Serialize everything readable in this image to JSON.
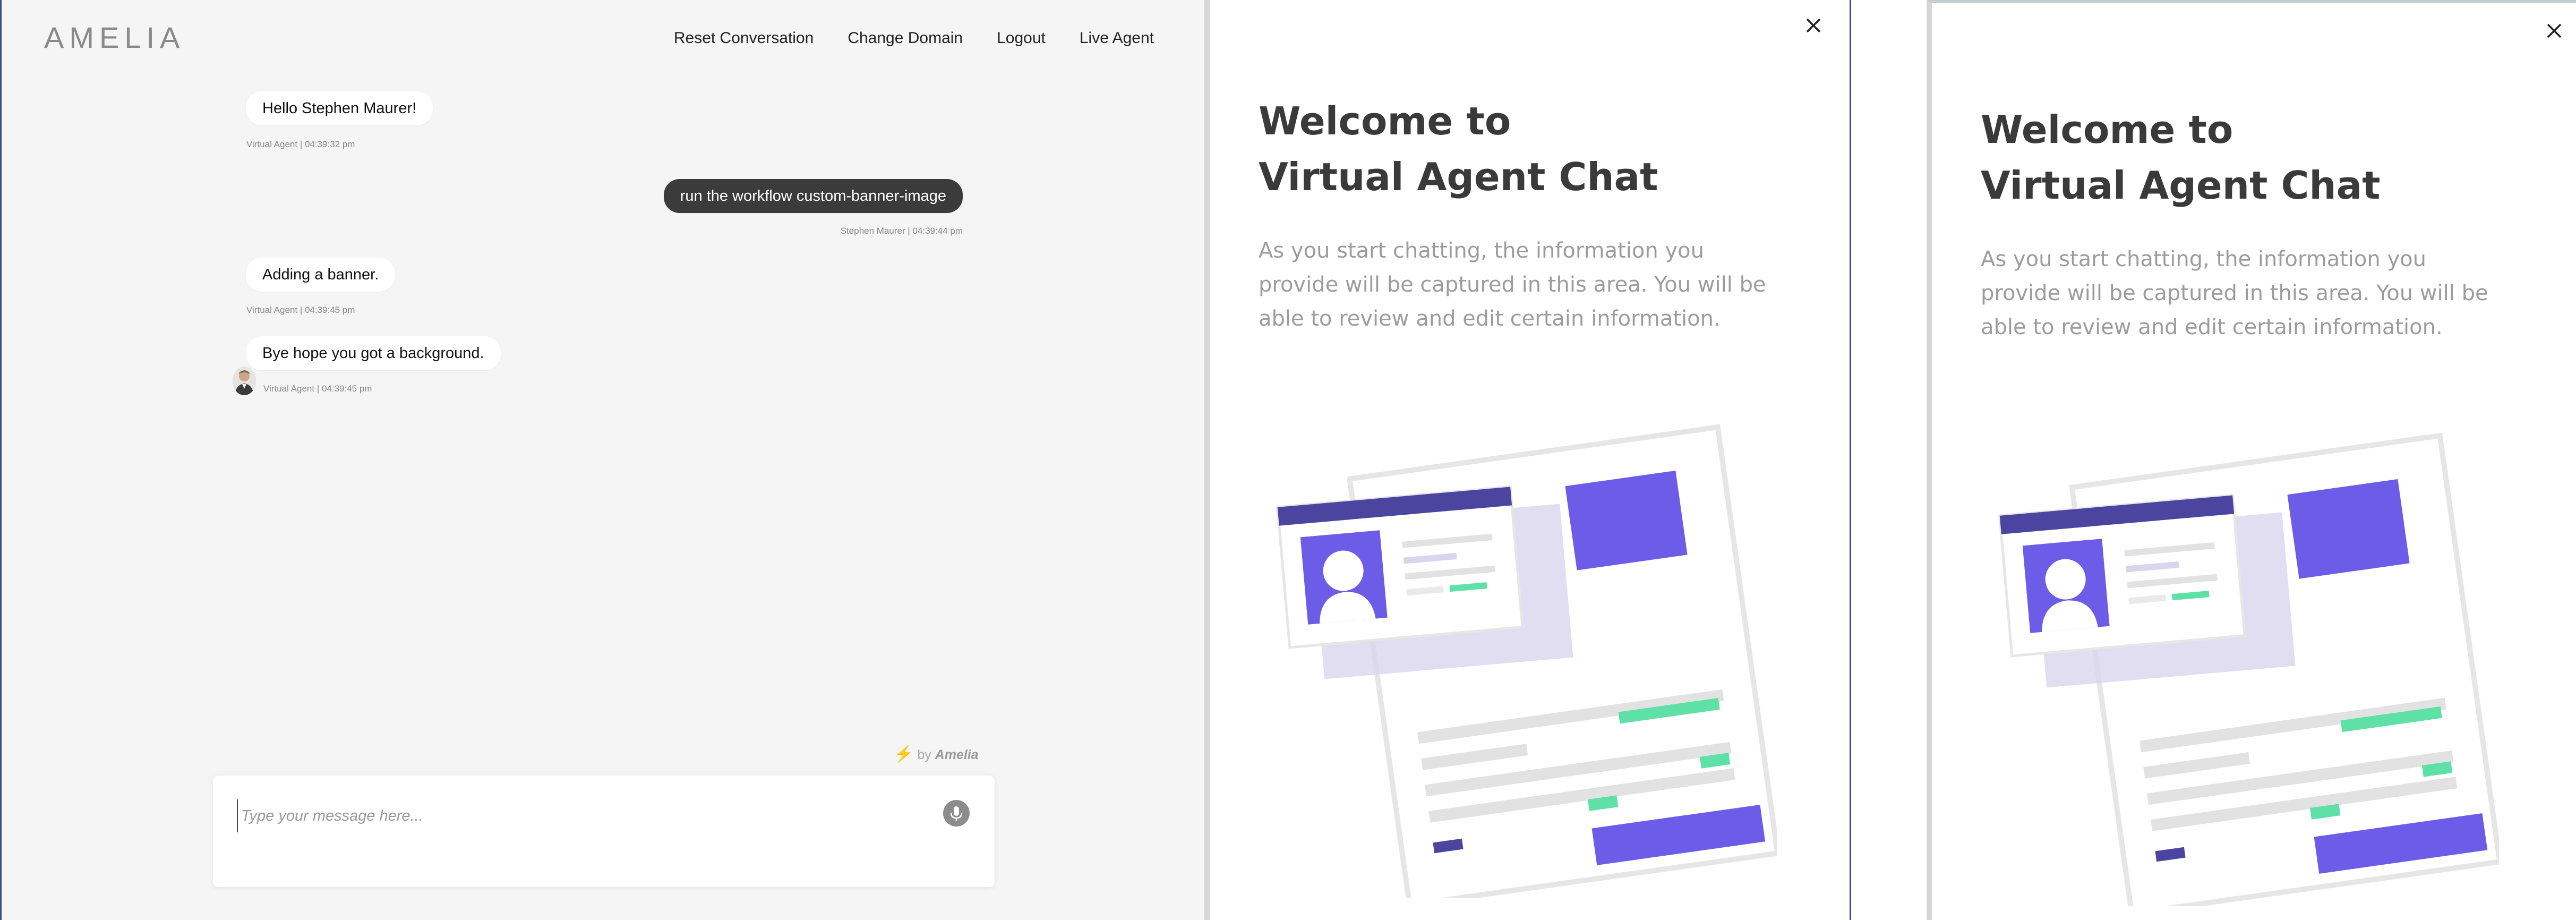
{
  "app": {
    "logo_text": "AMELIA"
  },
  "nav": {
    "reset": "Reset Conversation",
    "change_domain": "Change Domain",
    "logout": "Logout",
    "live_agent": "Live Agent"
  },
  "messages": [
    {
      "sender": "agent",
      "text": "Hello Stephen Maurer!",
      "meta": "Virtual Agent | 04:39:32 pm"
    },
    {
      "sender": "user",
      "text": "run the workflow custom-banner-image",
      "meta": "Stephen Maurer | 04:39:44 pm"
    },
    {
      "sender": "agent",
      "text": "Adding a banner.",
      "meta": "Virtual Agent | 04:39:45 pm"
    },
    {
      "sender": "agent",
      "text": "Bye hope you got a background.",
      "meta": "Virtual Agent | 04:39:45 pm"
    }
  ],
  "powered": {
    "prefix": "by",
    "brand": "Amelia"
  },
  "composer": {
    "placeholder": "Type your message here..."
  },
  "panel": {
    "title_line1": "Welcome to",
    "title_line2": "Virtual Agent Chat",
    "body": "As you start chatting, the information you provide will be captured in this area. You will be able to review and edit certain information."
  },
  "icons": {
    "close": "close-icon",
    "mic": "microphone-icon",
    "bolt": "lightning-icon"
  },
  "colors": {
    "accent_purple": "#6c5ce7",
    "dark_purple": "#4b45a0",
    "green": "#5ee0a6",
    "user_bubble": "#3b3b3b",
    "frame_blue": "#3d4a8a"
  }
}
